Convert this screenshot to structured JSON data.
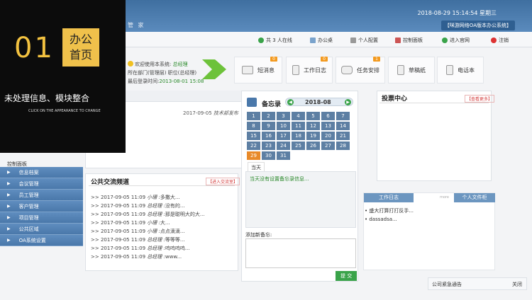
{
  "header": {
    "datetime": "2018-08-29 15:14:54 星期三",
    "system_name": "【咪游网络OA版本办公系统】",
    "brand_partial": "管 家"
  },
  "toolbar": {
    "online": "共 3 人在线",
    "office": "办公桌",
    "profile": "个人配置",
    "control": "控制面板",
    "website": "进入官网",
    "logout": "注销"
  },
  "welcome": {
    "line1_prefix": "欢迎使用本系统:",
    "user": "总经理",
    "line2": "所在部门(管理层) 职位(总经理)",
    "line3_prefix": "最后登录时间:",
    "last_login": "2013-08-01 15:08"
  },
  "modules": [
    {
      "label": "短消息",
      "count": "0"
    },
    {
      "label": "工作日志",
      "count": "0"
    },
    {
      "label": "任务安排",
      "count": "1"
    },
    {
      "label": "草稿纸",
      "count": ""
    },
    {
      "label": "电话本",
      "count": ""
    }
  ],
  "overlay": {
    "number": "01",
    "box_line1": "办公",
    "box_line2": "首页",
    "title": "未处理信息、模块整合",
    "subtitle": "CLICK ON THE APPEARANCE TO CHANGE"
  },
  "notice": {
    "date": "2017-09-05",
    "text": "技术部发布"
  },
  "sidebar": {
    "control_label": "控制面板",
    "items": [
      "信息档案",
      "会议管理",
      "员工管理",
      "客户管理",
      "项目管理",
      "公共区域",
      "OA系统设置"
    ]
  },
  "exchange": {
    "title": "公共交流频道",
    "link": "【进入交流室】",
    "rows": [
      {
        "time": ">> 2017-09-05 11:09",
        "user": "小珊 :",
        "text": "多撒大..."
      },
      {
        "time": ">> 2017-09-05 11:09",
        "user": "总经理 :",
        "text": "没有的..."
      },
      {
        "time": ">> 2017-09-05 11:09",
        "user": "总经理 :",
        "text": "那是聪明大的大..."
      },
      {
        "time": ">> 2017-09-05 11:09",
        "user": "小珊 :",
        "text": "大..."
      },
      {
        "time": ">> 2017-09-05 11:09",
        "user": "小珊 :",
        "text": "点点滴滴..."
      },
      {
        "time": ">> 2017-09-05 11:09",
        "user": "总经理 :",
        "text": "等等等..."
      },
      {
        "time": ">> 2017-09-05 11:09",
        "user": "总经理 :",
        "text": "呜呜呜呜..."
      },
      {
        "time": ">> 2017-09-05 11:09",
        "user": "总经理 :",
        "text": "www..."
      }
    ]
  },
  "memo": {
    "title": "备忘录",
    "month": "2018-08",
    "days": [
      "1",
      "2",
      "3",
      "4",
      "5",
      "6",
      "7",
      "8",
      "9",
      "10",
      "11",
      "12",
      "13",
      "14",
      "15",
      "16",
      "17",
      "18",
      "19",
      "20",
      "21",
      "22",
      "23",
      "24",
      "25",
      "26",
      "27",
      "28",
      "29",
      "30",
      "31"
    ],
    "today": "29",
    "tab": "当天",
    "empty": "当天没有设置备忘录信息...",
    "add_label": "添加新备忘:",
    "submit": "提 交"
  },
  "vote": {
    "title": "投票中心",
    "link": "【查看更多】"
  },
  "logs": {
    "tab_work": "工作日志",
    "tab_more": "more",
    "tab_personal": "个人文件柜",
    "items": [
      "盛大打算打打反手...",
      "dassadsa..."
    ]
  },
  "alert": {
    "title": "公司紧急通告",
    "close": "关闭"
  }
}
